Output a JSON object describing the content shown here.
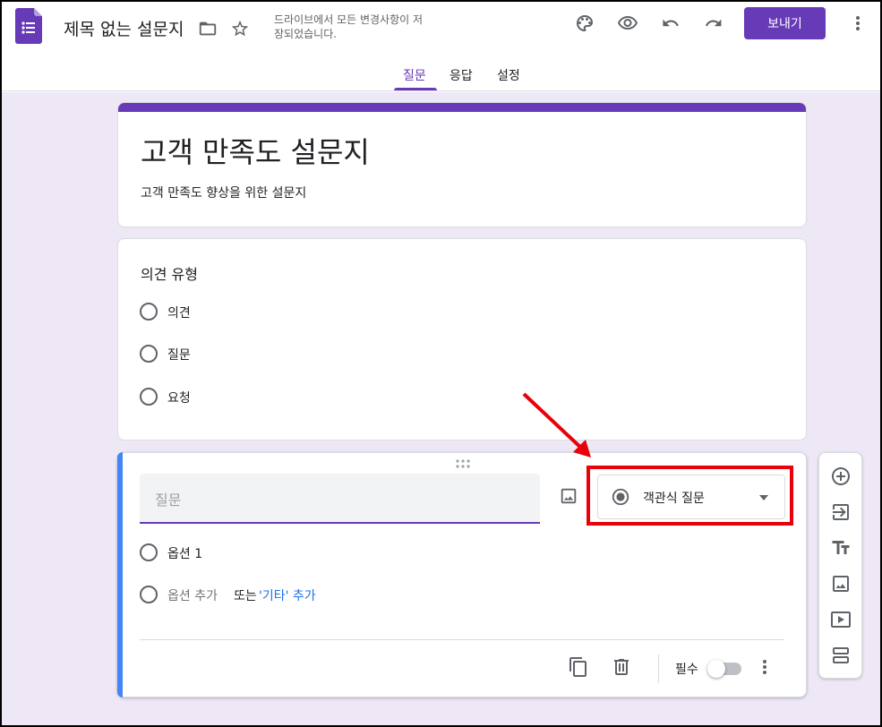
{
  "header": {
    "doc_title": "제목 없는 설문지",
    "save_status": "드라이브에서 모든 변경사항이 저장되었습니다.",
    "send_label": "보내기",
    "icons": [
      "forms-logo-icon",
      "folder-icon",
      "star-icon",
      "palette-icon",
      "preview-eye-icon",
      "undo-icon",
      "redo-icon",
      "more-vert-icon"
    ]
  },
  "tabs": [
    {
      "label": "질문",
      "active": true
    },
    {
      "label": "응답",
      "active": false
    },
    {
      "label": "설정",
      "active": false
    }
  ],
  "form": {
    "title": "고객 만족도 설문지",
    "description": "고객 만족도 향상을 위한 설문지"
  },
  "question1": {
    "title": "의견 유형",
    "options": [
      "의견",
      "질문",
      "요청"
    ]
  },
  "question2": {
    "placeholder": "질문",
    "type_label": "객관식 질문",
    "option1": "옵션 1",
    "add_option": "옵션 추가",
    "or": "또는",
    "add_other": "'기타' 추가",
    "required_label": "필수",
    "required": false
  },
  "colors": {
    "accent": "#673ab7",
    "canvas_bg": "#ede7f6",
    "active_bar": "#4285f4",
    "highlight": "#e8000a",
    "link": "#1a73e8"
  }
}
